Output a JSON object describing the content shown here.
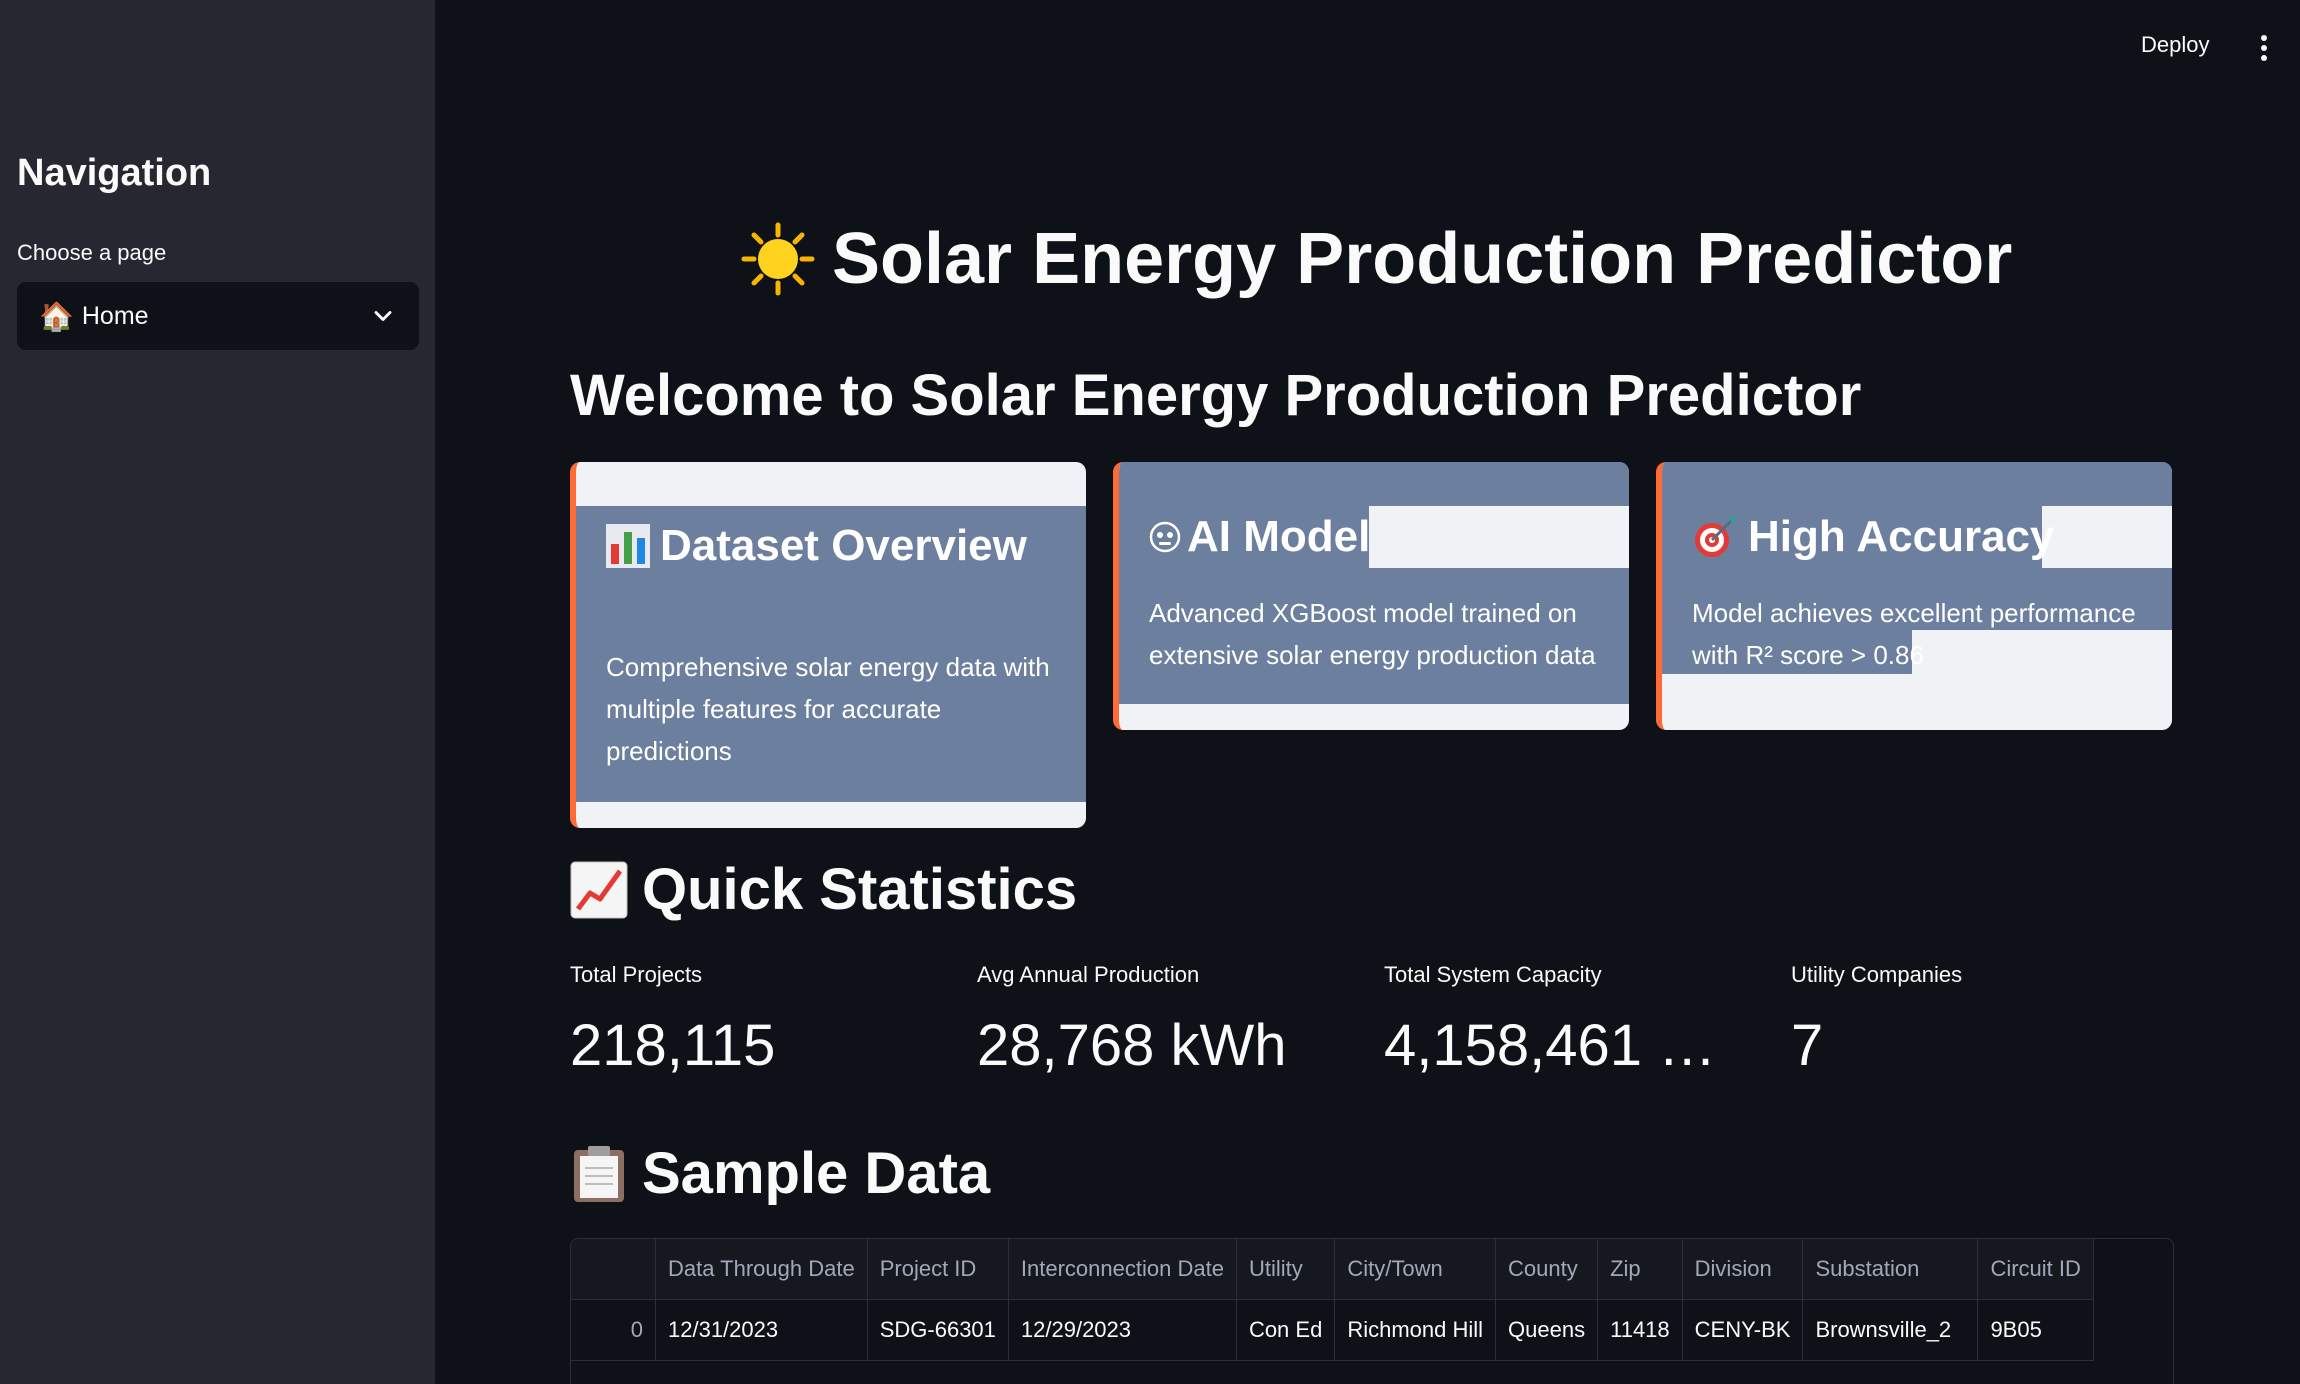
{
  "header": {
    "deploy_label": "Deploy"
  },
  "sidebar": {
    "title": "Navigation",
    "select_label": "Choose a page",
    "selected_page": "Home"
  },
  "main": {
    "title": "Solar Energy Production Predictor",
    "welcome": "Welcome to Solar Energy Production Predictor",
    "cards": [
      {
        "title": "Dataset Overview",
        "description": "Comprehensive solar energy data with multiple features for accurate predictions",
        "icon": "bar-chart-icon"
      },
      {
        "title": "AI Model",
        "description": "Advanced XGBoost model trained on extensive solar energy production data",
        "icon": "robot-icon"
      },
      {
        "title": "High Accuracy",
        "description": "Model achieves excellent performance with R² score > 0.86",
        "icon": "target-icon"
      }
    ],
    "stats_heading": "Quick Statistics",
    "metrics": [
      {
        "label": "Total Projects",
        "value": "218,115"
      },
      {
        "label": "Avg Annual Production",
        "value": "28,768 kWh"
      },
      {
        "label": "Total System Capacity",
        "value": "4,158,461 k…"
      },
      {
        "label": "Utility Companies",
        "value": "7"
      }
    ],
    "sample_heading": "Sample Data",
    "table": {
      "columns": [
        "",
        "Data Through Date",
        "Project ID",
        "Interconnection Date",
        "Utility",
        "City/Town",
        "County",
        "Zip",
        "Division",
        "Substation",
        "Circuit ID"
      ],
      "rows": [
        [
          "0",
          "12/31/2023",
          "SDG-66301",
          "12/29/2023",
          "Con Ed",
          "Richmond Hill",
          "Queens",
          "11418",
          "CENY-BK",
          "Brownsville_2",
          "9B05"
        ]
      ]
    }
  }
}
